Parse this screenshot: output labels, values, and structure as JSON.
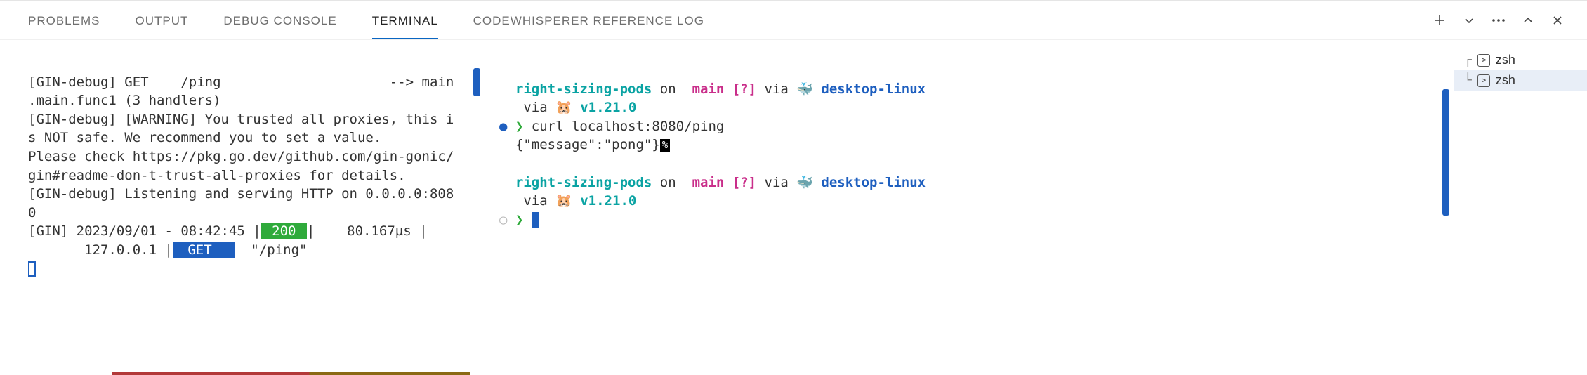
{
  "tabs": {
    "problems": "PROBLEMS",
    "output": "OUTPUT",
    "debug_console": "DEBUG CONSOLE",
    "terminal": "TERMINAL",
    "codewhisperer": "CODEWHISPERER REFERENCE LOG"
  },
  "left_terminal": {
    "l1": "[GIN-debug] GET    /ping                     --> main",
    "l2": ".main.func1 (3 handlers)",
    "l3": "[GIN-debug] [WARNING] You trusted all proxies, this i",
    "l4": "s NOT safe. We recommend you to set a value.",
    "l5": "Please check https://pkg.go.dev/github.com/gin-gonic/",
    "l6": "gin#readme-don-t-trust-all-proxies for details.",
    "l7": "[GIN-debug] Listening and serving HTTP on 0.0.0.0:808",
    "l8": "0",
    "log_prefix": "[GIN] 2023/09/01 - 08:42:45 |",
    "status": " 200 ",
    "log_mid": "|    80.167µs |",
    "log_ip": "       127.0.0.1 |",
    "method": " GET  ",
    "path": "  \"/ping\""
  },
  "right_terminal": {
    "dir": "right-sizing-pods",
    "on": " on ",
    "branch_icon": "",
    "branch": " main ",
    "q": "[?]",
    "via": " via ",
    "whale": "🐳 ",
    "context": "desktop-linux",
    "via2": "   via ",
    "hamster": "🐹 ",
    "version": "v1.21.0",
    "cmd_arrow": "❯",
    "cmd": " curl localhost:8080/ping",
    "response": "{\"message\":\"pong\"}",
    "percent": "%"
  },
  "sidebar": {
    "shell1": "zsh",
    "shell2": "zsh"
  },
  "icons": {
    "plus": "plus-icon",
    "chev_down": "chevron-down-icon",
    "dots": "ellipsis-icon",
    "chev_up": "chevron-up-icon",
    "close": "close-icon"
  }
}
